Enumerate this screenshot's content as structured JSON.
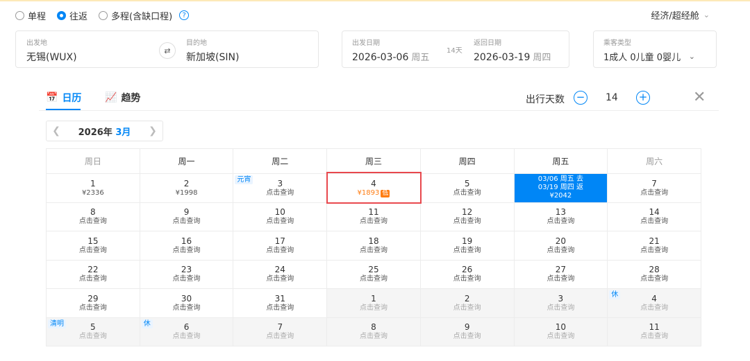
{
  "trip_types": [
    {
      "label": "单程",
      "selected": false
    },
    {
      "label": "往返",
      "selected": true
    },
    {
      "label": "多程(含缺口程)",
      "selected": false
    }
  ],
  "help_icon": "?",
  "cabin_class": "经济/超经舱",
  "origin": {
    "label": "出发地",
    "value": "无锡(WUX)"
  },
  "destination": {
    "label": "目的地",
    "value": "新加坡(SIN)"
  },
  "depart": {
    "label": "出发日期",
    "date": "2026-03-06",
    "weekday": "周五"
  },
  "return": {
    "label": "返回日期",
    "date": "2026-03-19",
    "weekday": "周四"
  },
  "trip_length_badge": "14天",
  "passengers": {
    "label": "乘客类型",
    "value": "1成人  0儿童  0婴儿"
  },
  "tabs": [
    {
      "label": "日历",
      "icon": "calendar-icon",
      "active": true
    },
    {
      "label": "趋势",
      "icon": "trend-chart-icon",
      "active": false
    }
  ],
  "travel_days": {
    "label": "出行天数",
    "value": "14",
    "minus": "−",
    "plus": "+"
  },
  "close_symbol": "✕",
  "month_nav": {
    "year": "2026年",
    "month": "3月"
  },
  "weekdays": [
    "周日",
    "周一",
    "周二",
    "周三",
    "周四",
    "周五",
    "周六"
  ],
  "weeks": [
    [
      {
        "day": "1",
        "price": "¥2336"
      },
      {
        "day": "2",
        "price": "¥1998"
      },
      {
        "day": "3",
        "price": "点击查询",
        "holiday": "元宵"
      },
      {
        "day": "4",
        "price": "¥1893",
        "low_tag": "低",
        "lowest": true
      },
      {
        "day": "5",
        "price": "点击查询"
      },
      {
        "selected": true,
        "line1": "03/06 周五 去",
        "line2": "03/19 周四 返",
        "line3": "¥2042"
      },
      {
        "day": "7",
        "price": "点击查询"
      }
    ],
    [
      {
        "day": "8",
        "price": "点击查询"
      },
      {
        "day": "9",
        "price": "点击查询"
      },
      {
        "day": "10",
        "price": "点击查询"
      },
      {
        "day": "11",
        "price": "点击查询"
      },
      {
        "day": "12",
        "price": "点击查询"
      },
      {
        "day": "13",
        "price": "点击查询"
      },
      {
        "day": "14",
        "price": "点击查询"
      }
    ],
    [
      {
        "day": "15",
        "price": "点击查询"
      },
      {
        "day": "16",
        "price": "点击查询"
      },
      {
        "day": "17",
        "price": "点击查询"
      },
      {
        "day": "18",
        "price": "点击查询"
      },
      {
        "day": "19",
        "price": "点击查询"
      },
      {
        "day": "20",
        "price": "点击查询"
      },
      {
        "day": "21",
        "price": "点击查询"
      }
    ],
    [
      {
        "day": "22",
        "price": "点击查询"
      },
      {
        "day": "23",
        "price": "点击查询"
      },
      {
        "day": "24",
        "price": "点击查询"
      },
      {
        "day": "25",
        "price": "点击查询"
      },
      {
        "day": "26",
        "price": "点击查询"
      },
      {
        "day": "27",
        "price": "点击查询"
      },
      {
        "day": "28",
        "price": "点击查询"
      }
    ],
    [
      {
        "day": "29",
        "price": "点击查询"
      },
      {
        "day": "30",
        "price": "点击查询"
      },
      {
        "day": "31",
        "price": "点击查询"
      },
      {
        "day": "1",
        "price": "点击查询",
        "other": true
      },
      {
        "day": "2",
        "price": "点击查询",
        "other": true
      },
      {
        "day": "3",
        "price": "点击查询",
        "other": true
      },
      {
        "day": "4",
        "price": "点击查询",
        "other": true,
        "holiday": "休"
      }
    ],
    [
      {
        "day": "5",
        "price": "点击查询",
        "other": true,
        "holiday": "清明"
      },
      {
        "day": "6",
        "price": "点击查询",
        "other": true,
        "holiday": "休"
      },
      {
        "day": "7",
        "price": "点击查询",
        "other": true
      },
      {
        "day": "8",
        "price": "点击查询",
        "other": true
      },
      {
        "day": "9",
        "price": "点击查询",
        "other": true
      },
      {
        "day": "10",
        "price": "点击查询",
        "other": true
      },
      {
        "day": "11",
        "price": "点击查询",
        "other": true
      }
    ]
  ],
  "colors": {
    "accent": "#0086f6",
    "lowest": "#ff7d13",
    "highlight": "#e8484d"
  }
}
